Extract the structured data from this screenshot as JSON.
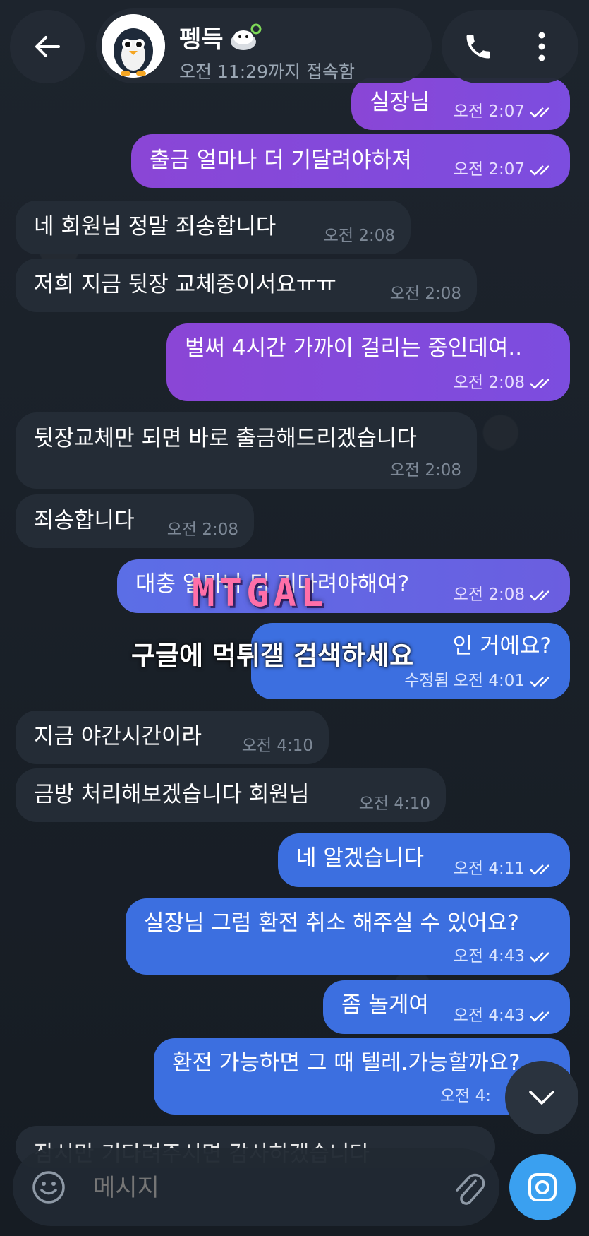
{
  "header": {
    "contact_name": "펭득",
    "status": "오전 11:29까지 접속함"
  },
  "messages": [
    {
      "dir": "out",
      "text": "실장님",
      "time": "오전 2:07"
    },
    {
      "dir": "out",
      "text": "출금 얼마나 더 기달려야하져",
      "time": "오전 2:07"
    },
    {
      "dir": "in",
      "text": "네 회원님 정말 죄송합니다",
      "time": "오전 2:08"
    },
    {
      "dir": "in",
      "text": "저희 지금 뒷장 교체중이서요ㅠㅠ",
      "time": "오전 2:08"
    },
    {
      "dir": "out",
      "text": "벌써 4시간 가까이 걸리는 중인데여..",
      "time": "오전 2:08"
    },
    {
      "dir": "in",
      "text": "뒷장교체만 되면 바로 출금해드리겠습니다",
      "time": "오전 2:08"
    },
    {
      "dir": "in",
      "text": "죄송합니다",
      "time": "오전 2:08"
    },
    {
      "dir": "out",
      "text": "대충 얼마나 더 기다려야해여?",
      "time": "오전 2:08"
    },
    {
      "dir": "out",
      "text": "인 거에요?",
      "time": "오전 4:01",
      "edited": "수정됨"
    },
    {
      "dir": "in",
      "text": "지금 야간시간이라",
      "time": "오전 4:10"
    },
    {
      "dir": "in",
      "text": "금방 처리해보겠습니다 회원님",
      "time": "오전 4:10"
    },
    {
      "dir": "out",
      "text": "네 알겠습니다",
      "time": "오전 4:11"
    },
    {
      "dir": "out",
      "text": "실장님 그럼 환전 취소 해주실 수 있어요?",
      "time": "오전 4:43"
    },
    {
      "dir": "out",
      "text": "좀 놀게여",
      "time": "오전 4:43"
    },
    {
      "dir": "out",
      "text": "환전 가능하면 그 때 텔레.가능할까요?",
      "time": "오전 4:"
    },
    {
      "dir": "in",
      "text": "잠시만 기다려주시면 감사하겠습니다",
      "time": ""
    }
  ],
  "watermark": {
    "logo": "MTGAL",
    "text": "구글에 먹튀갤 검색하세요"
  },
  "input": {
    "placeholder": "메시지"
  },
  "colors": {
    "background": "#1a2028",
    "outgoing_purple": "#8a46d6",
    "outgoing_blue": "#3c6fe0",
    "incoming": "#242c36",
    "send_button": "#3aa0f0"
  },
  "icons": [
    "back-arrow-icon",
    "phone-icon",
    "more-vertical-icon",
    "double-check-icon",
    "chevron-down-icon",
    "emoji-icon",
    "paperclip-icon",
    "camera-icon"
  ]
}
